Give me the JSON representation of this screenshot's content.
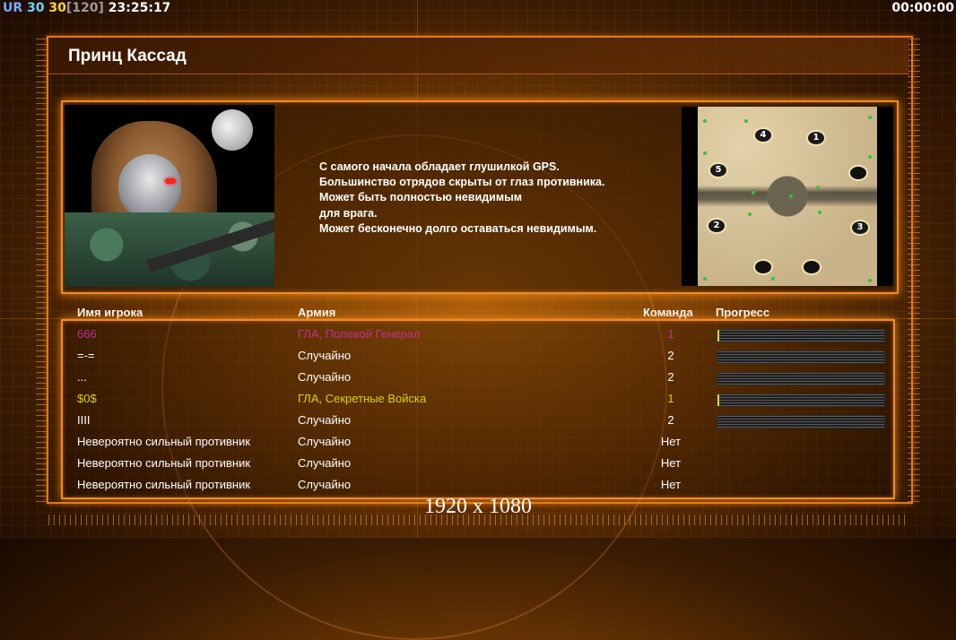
{
  "hud": {
    "tag": "UR",
    "fps": "30",
    "fps_cap": "30",
    "fps_max": "[120]",
    "clock": "23:25:17",
    "timer": "00:00:00"
  },
  "general": {
    "name": "Принц Кассад",
    "description_lines": [
      "С самого начала обладает глушилкой GPS.",
      "Большинство отрядов скрыты от глаз противника.",
      "Может быть полностью невидимым",
      "для врага.",
      "Может бесконечно долго оставаться невидимым."
    ]
  },
  "minimap": {
    "spots": [
      "4",
      "1",
      "5",
      "",
      "2",
      "3",
      "",
      ""
    ]
  },
  "columns": {
    "name": "Имя игрока",
    "army": "Армия",
    "team": "Команда",
    "progress": "Прогресс"
  },
  "players": [
    {
      "name": "666",
      "army": "ГЛА, Полевой Генерал",
      "team": "1",
      "color": "#c0308a",
      "progress": 0.01
    },
    {
      "name": "=-=",
      "army": "Случайно",
      "team": "2",
      "color": "#ffffff",
      "progress": 0
    },
    {
      "name": "...",
      "army": "Случайно",
      "team": "2",
      "color": "#ffffff",
      "progress": 0
    },
    {
      "name": "$0$",
      "army": "ГЛА, Секретные Войска",
      "team": "1",
      "color": "#d4d400",
      "progress": 0.01
    },
    {
      "name": "IIII",
      "army": "Случайно",
      "team": "2",
      "color": "#ffffff",
      "progress": 0
    },
    {
      "name": "Невероятно сильный противник",
      "army": "Случайно",
      "team": "Нет",
      "color": "#ffffff"
    },
    {
      "name": "Невероятно сильный противник",
      "army": "Случайно",
      "team": "Нет",
      "color": "#ffffff"
    },
    {
      "name": "Невероятно сильный противник",
      "army": "Случайно",
      "team": "Нет",
      "color": "#ffffff"
    }
  ],
  "resolution_label": "1920 x 1080"
}
